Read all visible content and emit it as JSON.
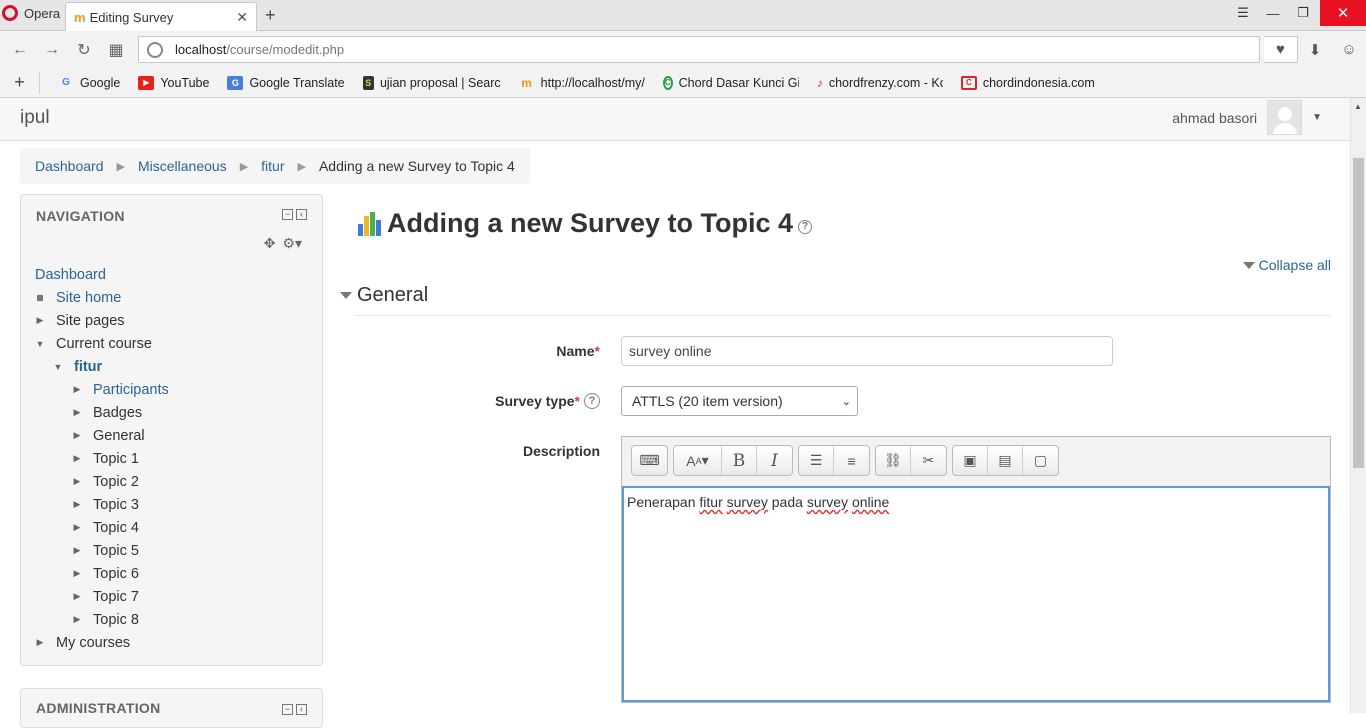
{
  "browser": {
    "menu_label": "Opera",
    "tab_title": "Editing Survey",
    "url_host": "localhost",
    "url_path": "/course/modedit.php",
    "bookmarks": [
      {
        "label": "Google",
        "icon": "google-icon"
      },
      {
        "label": "YouTube",
        "icon": "youtube-icon"
      },
      {
        "label": "Google Translate",
        "icon": "translate-icon"
      },
      {
        "label": "ujian proposal | Searc",
        "icon": "bookmark-icon"
      },
      {
        "label": "http://localhost/my/",
        "icon": "moodle-icon"
      },
      {
        "label": "Chord Dasar Kunci Gi",
        "icon": "chord-icon"
      },
      {
        "label": "chordfrenzy.com - Ko",
        "icon": "guitar-icon"
      },
      {
        "label": "chordindonesia.com",
        "icon": "chordindonesia-icon"
      }
    ]
  },
  "header": {
    "brand": "ipul",
    "user_name": "ahmad basori"
  },
  "breadcrumb": [
    "Dashboard",
    "Miscellaneous",
    "fitur",
    "Adding a new Survey to Topic 4"
  ],
  "navigation": {
    "title": "NAVIGATION",
    "items": [
      {
        "label": "Dashboard"
      },
      {
        "label": "Site home"
      },
      {
        "label": "Site pages"
      },
      {
        "label": "Current course"
      },
      {
        "label": "fitur"
      },
      {
        "label": "Participants"
      },
      {
        "label": "Badges"
      },
      {
        "label": "General"
      },
      {
        "label": "Topic 1"
      },
      {
        "label": "Topic 2"
      },
      {
        "label": "Topic 3"
      },
      {
        "label": "Topic 4"
      },
      {
        "label": "Topic 5"
      },
      {
        "label": "Topic 6"
      },
      {
        "label": "Topic 7"
      },
      {
        "label": "Topic 8"
      },
      {
        "label": "My courses"
      }
    ]
  },
  "administration": {
    "title": "ADMINISTRATION"
  },
  "main": {
    "heading": "Adding a new Survey to Topic 4",
    "collapse_all": "Collapse all",
    "section_title": "General",
    "required_mark": "*",
    "name_label": "Name",
    "name_value": "survey online",
    "survey_type_label": "Survey type",
    "survey_type_value": "ATTLS (20 item version)",
    "description_label": "Description",
    "description_value": {
      "w1": "Penerapan",
      "w2": "fitur",
      "w3": "survey",
      "w4": "pada",
      "w5": "survey",
      "w6": "online"
    }
  },
  "colors": {
    "link": "#2a6496",
    "required": "#b94a48",
    "editor_focus": "#5b9bd5"
  }
}
